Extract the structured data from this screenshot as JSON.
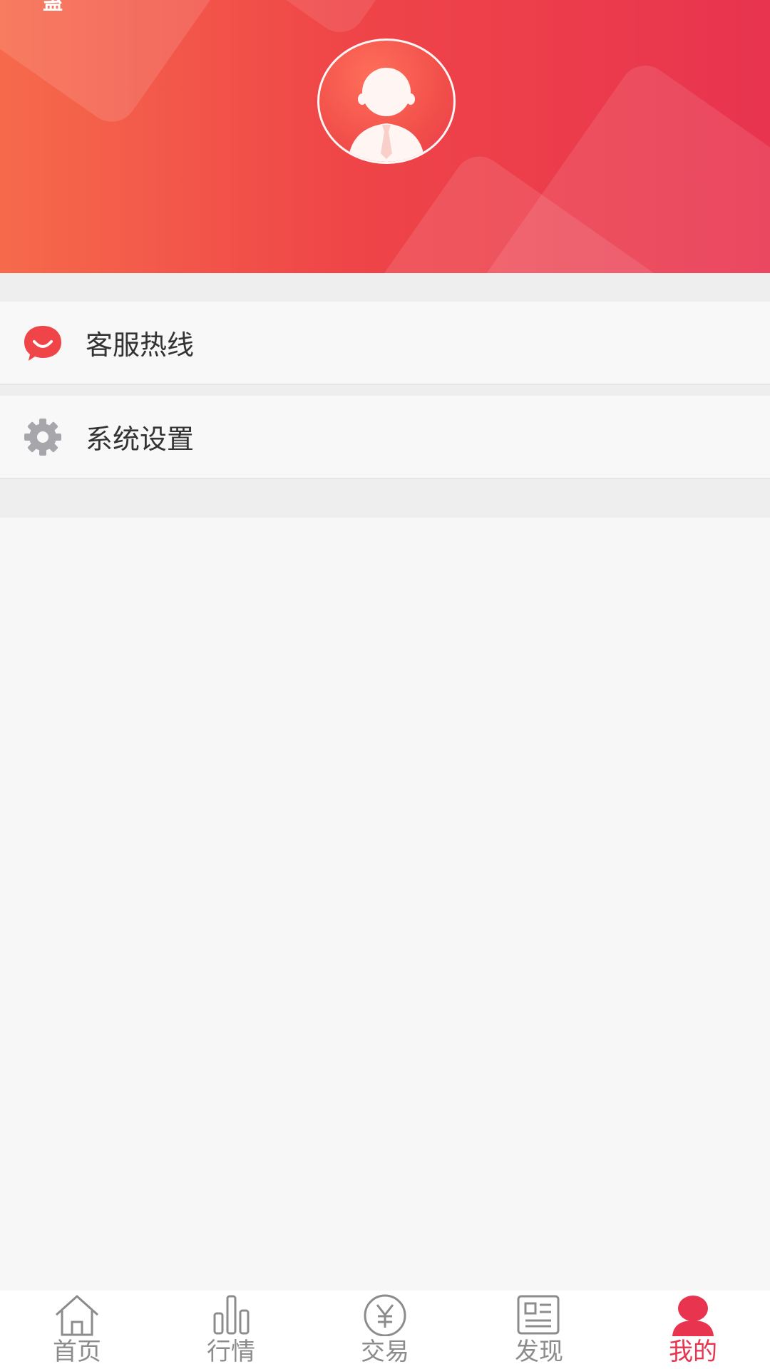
{
  "header": {
    "status_glyph": "蛊",
    "avatar_icon": "user-avatar-icon",
    "gradient": [
      "#f66a4b",
      "#e8344f"
    ]
  },
  "menu": {
    "items": [
      {
        "label": "客服热线",
        "icon": "chat-bubble-icon",
        "icon_color": "#ef4548"
      },
      {
        "label": "系统设置",
        "icon": "gear-icon",
        "icon_color": "#a7a7ab"
      }
    ]
  },
  "tabbar": {
    "active_color": "#e8344f",
    "inactive_color": "#8c8c8c",
    "tabs": [
      {
        "label": "首页",
        "icon": "home-icon"
      },
      {
        "label": "行情",
        "icon": "bar-chart-icon"
      },
      {
        "label": "交易",
        "icon": "yen-coin-icon"
      },
      {
        "label": "发现",
        "icon": "news-icon"
      },
      {
        "label": "我的",
        "icon": "user-icon",
        "active": true
      }
    ]
  }
}
